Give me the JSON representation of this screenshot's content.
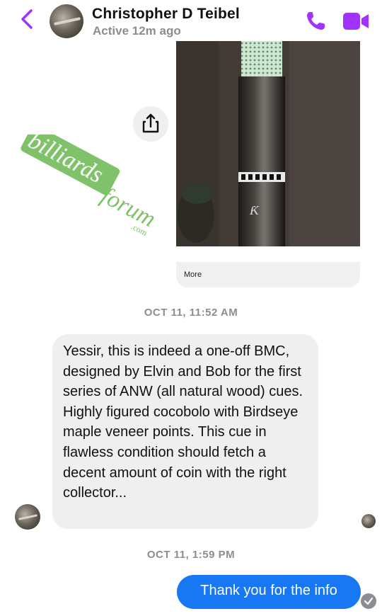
{
  "header": {
    "contact_name": "Christopher D Teibel",
    "status": "Active 12m ago",
    "icons": [
      "back-chevron-icon",
      "phone-icon",
      "video-camera-icon"
    ],
    "accent_color": "#a033ff"
  },
  "shared_post": {
    "more_label": "More",
    "share_icon": "share-icon"
  },
  "watermark": {
    "line1": "billiards",
    "line2": "forum",
    "suffix": ".com",
    "color": "#7fc26a"
  },
  "messages": [
    {
      "timestamp": "OCT 11, 11:52 AM",
      "sender": "Christopher D Teibel",
      "direction": "incoming",
      "text": "Yessir, this is indeed a one-off BMC, designed by Elvin and Bob for the first series of ANW (all natural wood) cues. Highly figured cocobolo with Birdseye maple veneer points. This cue in flawless condition should fetch a decent amount of coin with the right collector..."
    },
    {
      "timestamp": "OCT 11, 1:59 PM",
      "sender": "me",
      "direction": "outgoing",
      "text": "Thank you for the info",
      "status_icon": "delivered-check-icon"
    }
  ],
  "colors": {
    "outgoing_bubble": "#1877f2",
    "incoming_bubble": "#efefef",
    "meta_text": "#8a8d91"
  }
}
